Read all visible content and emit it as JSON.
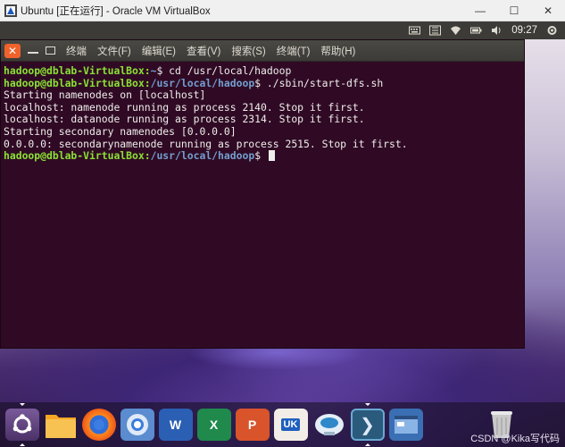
{
  "host_window": {
    "title": "Ubuntu [正在运行] - Oracle VM VirtualBox",
    "minimize_label": "—",
    "maximize_label": "☐",
    "close_label": "✕"
  },
  "top_panel": {
    "icons": [
      "keyboard-icon",
      "network-icon",
      "wifi-icon",
      "battery-icon",
      "volume-icon"
    ],
    "clock": "09:27"
  },
  "terminal": {
    "window_close_label": "✕",
    "menu": [
      "终端",
      "文件(F)",
      "编辑(E)",
      "查看(V)",
      "搜索(S)",
      "终端(T)",
      "帮助(H)"
    ],
    "lines": [
      {
        "user": "hadoop@dblab-VirtualBox",
        "path": "~",
        "cmd": "cd /usr/local/hadoop"
      },
      {
        "user": "hadoop@dblab-VirtualBox",
        "path": "/usr/local/hadoop",
        "cmd": "./sbin/start-dfs.sh"
      },
      {
        "text": "Starting namenodes on [localhost]"
      },
      {
        "text": "localhost: namenode running as process 2140. Stop it first."
      },
      {
        "text": "localhost: datanode running as process 2314. Stop it first."
      },
      {
        "text": "Starting secondary namenodes [0.0.0.0]"
      },
      {
        "text": "0.0.0.0: secondarynamenode running as process 2515. Stop it first."
      },
      {
        "user": "hadoop@dblab-VirtualBox",
        "path": "/usr/local/hadoop",
        "cmd": ""
      }
    ]
  },
  "dock": {
    "items": [
      "ubuntu-dash",
      "files",
      "firefox",
      "chromium",
      "word",
      "excel",
      "powerpoint",
      "software-center",
      "remote-desktop",
      "terminal",
      "workspace-switcher",
      "trash"
    ],
    "word_letter": "W",
    "excel_letter": "X",
    "powerpoint_letter": "P",
    "software_center_badge": "UK",
    "terminal_glyph": "❯"
  },
  "watermark": "CSDN @Kika写代码",
  "colors": {
    "terminal_bg": "#300a24",
    "prompt_user": "#8ae234",
    "prompt_path": "#729fcf",
    "close_button": "#f0622c",
    "panel": "#3c3b37"
  }
}
